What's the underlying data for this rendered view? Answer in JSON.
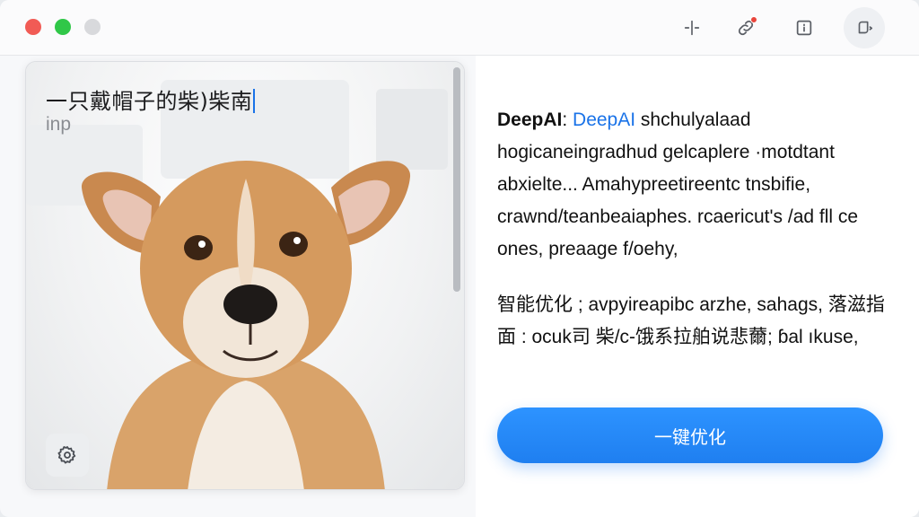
{
  "window": {
    "toolbar_icons": [
      "split-icon",
      "link-icon",
      "info-icon",
      "profile-icon"
    ]
  },
  "editor": {
    "prompt": "一只戴帽子的柴)柴南",
    "sub_text": "inp",
    "settings_icon": "gear-icon"
  },
  "preview": {
    "brand_bold": "DeepAI",
    "brand_sep": ": ",
    "brand_link": "DeepAI",
    "para1_rest": " shchulyalaad hogicaneingradhud gelcaplere ·motdtant abxielte... Amahypreetireentc tnsbifie, crawnd/teanbeaiaphes. rcaericut's /ad fll ce ones, preaage f/oehy,",
    "para2": "智能优化 ; avpyireapibc arzhe, sahags, 落滋指面 : ocuk司 柴/c-饿系拉舶说悲薾; ɓal ıkuse,"
  },
  "action": {
    "optimize_label": "一键优化"
  },
  "colors": {
    "accent": "#1f7ff0",
    "close": "#f15b55",
    "maximize": "#30c748",
    "minimize": "#d8d9dc"
  }
}
